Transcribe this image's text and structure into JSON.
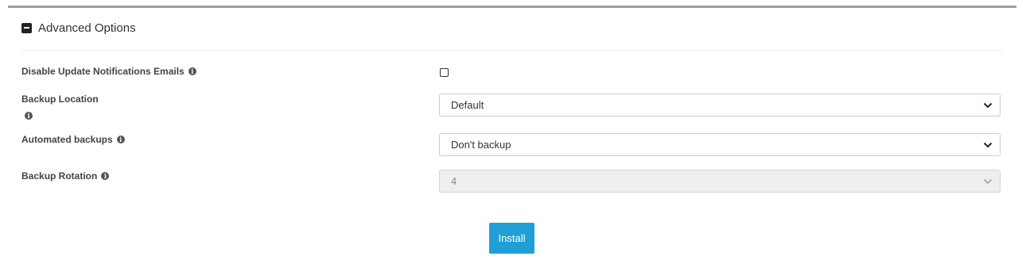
{
  "section": {
    "title": "Advanced Options",
    "collapse_icon": "minus-square-icon"
  },
  "fields": {
    "disable_notifications": {
      "label": "Disable Update Notifications Emails",
      "checked": false
    },
    "backup_location": {
      "label": "Backup Location",
      "value": "Default"
    },
    "automated_backups": {
      "label": "Automated backups",
      "value": "Don't backup"
    },
    "backup_rotation": {
      "label": "Backup Rotation",
      "value": "4",
      "disabled": true
    }
  },
  "info_icon_glyph": "i",
  "actions": {
    "install_label": "Install"
  },
  "colors": {
    "accent": "#1ea0d6",
    "rule": "#9e9e9e",
    "disabled_bg": "#eeeeee"
  }
}
